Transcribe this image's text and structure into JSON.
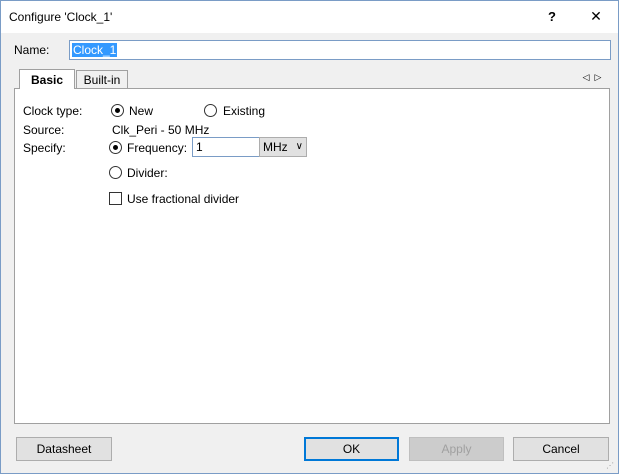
{
  "window": {
    "title": "Configure 'Clock_1'",
    "help_label": "?",
    "close_label": "✕"
  },
  "name": {
    "label": "Name:",
    "value": "Clock_1"
  },
  "tabs": [
    {
      "label": "Basic",
      "active": true
    },
    {
      "label": "Built-in",
      "active": false
    }
  ],
  "tab_scroll": {
    "left_icon": "◁",
    "right_icon": "▷"
  },
  "basic": {
    "clock_type_label": "Clock type:",
    "clock_type_options": [
      {
        "label": "New",
        "selected": true
      },
      {
        "label": "Existing",
        "selected": false
      }
    ],
    "source_label": "Source:",
    "source_value": "Clk_Peri - 50 MHz",
    "specify_label": "Specify:",
    "frequency_label": "Frequency:",
    "frequency_selected": true,
    "frequency_value": "1",
    "unit_value": "MHz",
    "unit_chevron": "∨",
    "divider_label": "Divider:",
    "divider_selected": false,
    "fractional_label": "Use fractional divider",
    "fractional_checked": false
  },
  "buttons": {
    "datasheet": "Datasheet",
    "ok": "OK",
    "apply": "Apply",
    "cancel": "Cancel"
  },
  "colors": {
    "accent": "#0078d7",
    "selection": "#3399ff",
    "input_border": "#7a9cc6"
  }
}
